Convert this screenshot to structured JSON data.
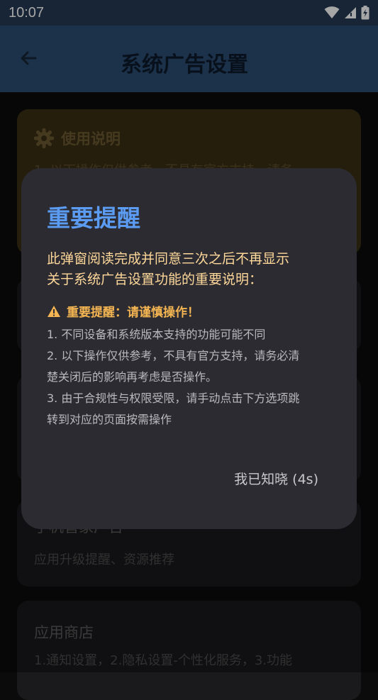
{
  "status_bar": {
    "time": "10:07",
    "icons": [
      "wifi-icon",
      "signal-icon",
      "battery-icon"
    ]
  },
  "app_bar": {
    "title": "系统广告设置",
    "back_icon": "arrow-left-icon"
  },
  "usage_card": {
    "icon": "gear-icon",
    "title": "使用说明",
    "text": "1. 以下操作仅供参考，不具有官方支持，请务"
  },
  "cards": [
    {
      "title": "手机管家广告",
      "desc": "应用升级提醒、资源推荐"
    },
    {
      "title": "应用商店",
      "desc": "1.通知设置，2.隐私设置-个性化服务，3.功能"
    }
  ],
  "dialog": {
    "title": "重要提醒",
    "lead_lines": [
      "此弹窗阅读完成并同意三次之后不再显示",
      "关于系统广告设置功能的重要说明："
    ],
    "warning_icon": "warning-triangle-icon",
    "warning": "重要提醒：请谨慎操作！",
    "items": [
      "1. 不同设备和系统版本支持的功能可能不同",
      "2. 以下操作仅供参考，不具有官方支持，请务必清",
      "楚关闭后的影响再考虑是否操作。",
      "3. 由于合规性与权限受限，请手动点击下方选项跳",
      "转到对应的页面按需操作"
    ],
    "confirm": "我已知晓 (4s)"
  },
  "colors": {
    "app_bar": "#2b4d74",
    "dialog_title": "#5b9cf2",
    "warning": "#f4b552",
    "lead_text": "#ffd89a",
    "dialog_bg": "#2b2b31"
  }
}
